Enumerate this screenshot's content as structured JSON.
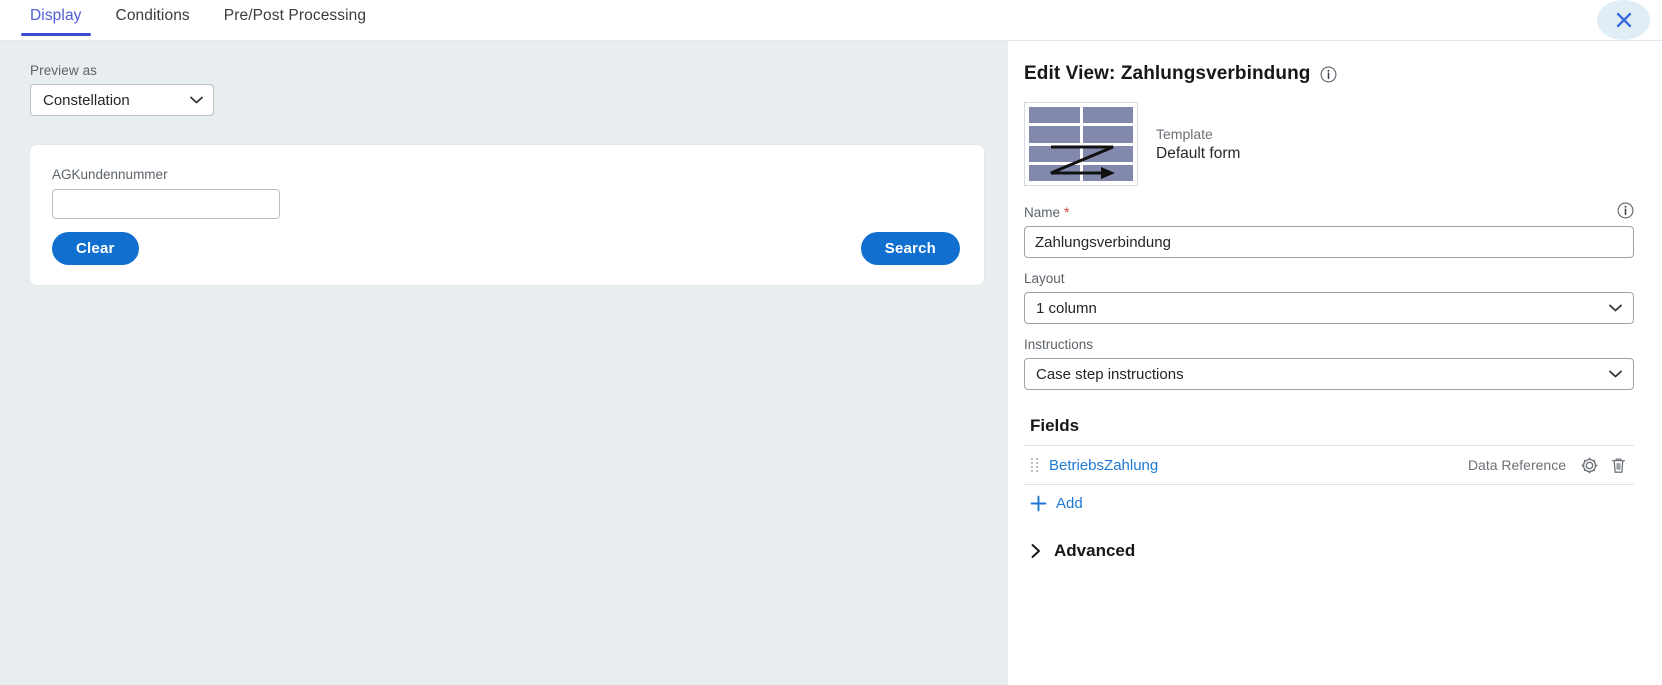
{
  "tabs": [
    {
      "label": "Display",
      "active": true
    },
    {
      "label": "Conditions",
      "active": false
    },
    {
      "label": "Pre/Post Processing",
      "active": false
    }
  ],
  "window": {
    "close_icon": "close-icon"
  },
  "preview": {
    "preview_as_label": "Preview as",
    "preview_as_value": "Constellation",
    "form": {
      "field_label": "AGKundennummer",
      "field_value": "",
      "field_placeholder": "",
      "clear_label": "Clear",
      "search_label": "Search"
    }
  },
  "editor": {
    "title": "Edit View: Zahlungsverbindung",
    "title_info_icon": "info-icon",
    "template": {
      "thumbnail_icon": "form-template-thumbnail-icon",
      "meta_label": "Template",
      "meta_value": "Default form"
    },
    "name": {
      "label": "Name",
      "required_marker": "*",
      "value": "Zahlungsverbindung",
      "info_icon": "info-icon"
    },
    "layout": {
      "label": "Layout",
      "value": "1 column"
    },
    "instructions": {
      "label": "Instructions",
      "value": "Case step instructions"
    },
    "fields": {
      "heading": "Fields",
      "rows": [
        {
          "name": "BetriebsZahlung",
          "type": "Data Reference",
          "settings_icon": "gear-icon",
          "delete_icon": "trash-icon"
        }
      ],
      "add_label": "Add"
    },
    "advanced": {
      "label": "Advanced",
      "expanded": false
    }
  },
  "colors": {
    "accent_blue": "#1170cf",
    "link_blue": "#1e79d4",
    "tab_active": "#3b4ccc",
    "panel_bg": "#e8edf0",
    "required_red": "#d3403c",
    "thumb_purple": "#8388ad"
  }
}
